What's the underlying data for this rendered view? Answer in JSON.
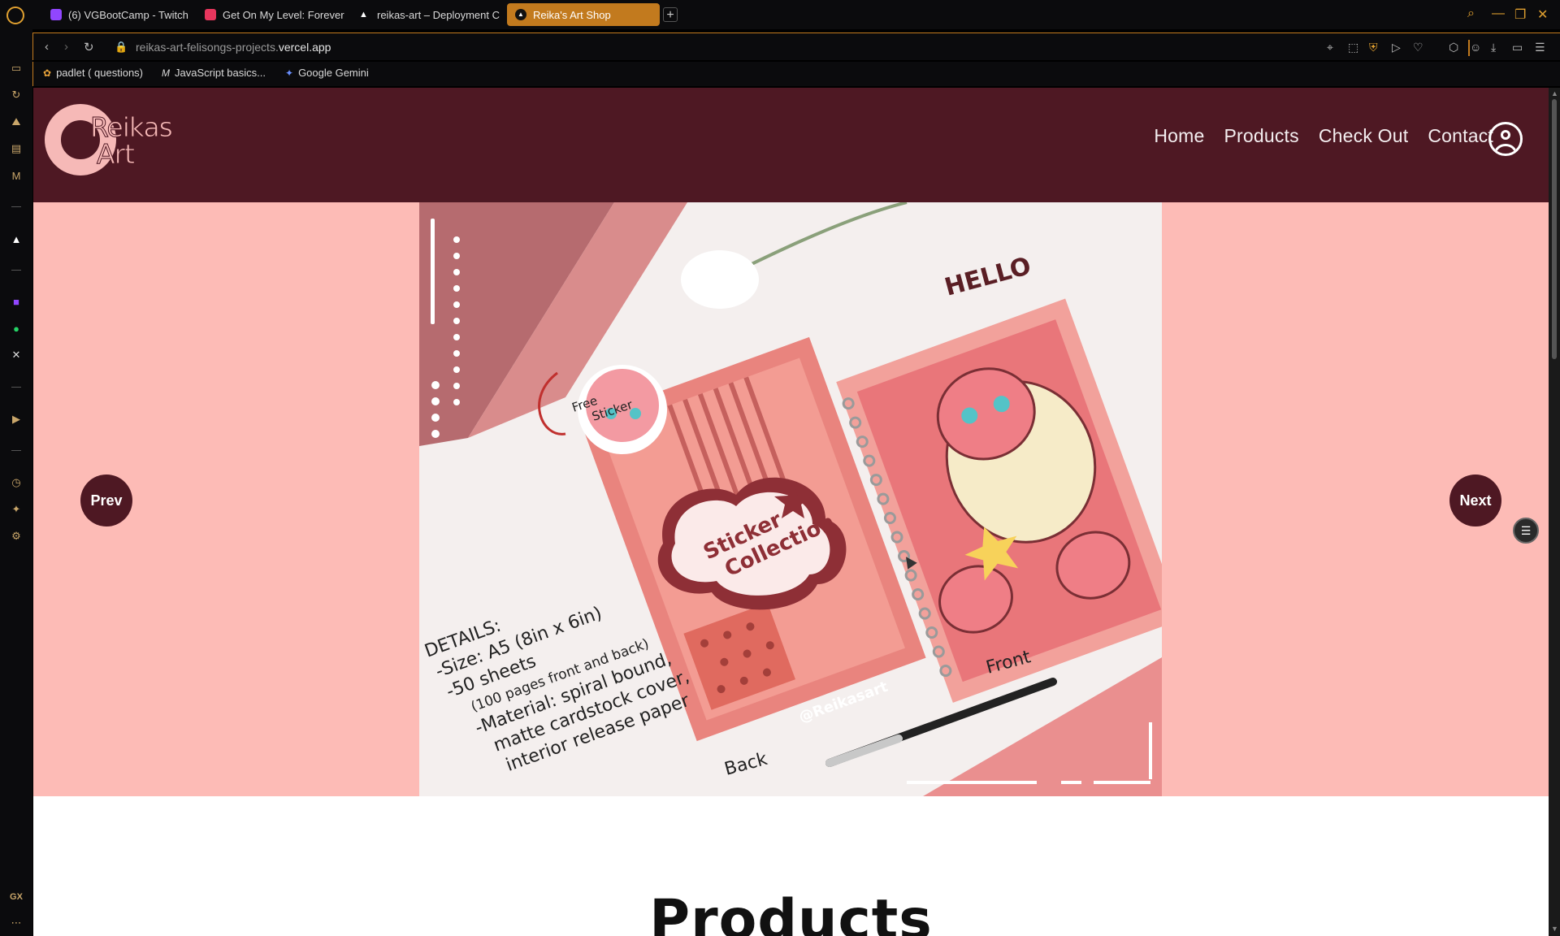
{
  "browser": {
    "tabs": [
      {
        "label": "(6) VGBootCamp - Twitch",
        "favicon_color": "#9146ff"
      },
      {
        "label": "Get On My Level: Forever",
        "favicon_color": "#e8365d"
      },
      {
        "label": "reikas-art – Deployment C",
        "favicon_color": "#ffffff"
      },
      {
        "label": "Reika's Art Shop",
        "favicon_color": "#000000",
        "active": true
      }
    ],
    "new_tab_label": "+",
    "url_path": "reikas-art-felisongs-projects.",
    "url_host": "vercel.app",
    "bookmarks": [
      {
        "label": "padlet ( questions)",
        "icon": "padlet-icon"
      },
      {
        "label": "JavaScript basics...",
        "icon": "medium-icon"
      },
      {
        "label": "Google Gemini",
        "icon": "gemini-icon"
      }
    ],
    "accent_color": "#c27a1e"
  },
  "sidebar_bottom_label": "GX",
  "site": {
    "logo_line1": "Reikas",
    "logo_line2": "Art",
    "nav": [
      "Home",
      "Products",
      "Check Out",
      "Contact"
    ],
    "header_color": "#4e1823",
    "hero_bg_color": "#fdbbb6"
  },
  "hero": {
    "prev_label": "Prev",
    "next_label": "Next",
    "slide": {
      "free_sticker": "Free\nSticker",
      "hello": "HELLO",
      "sticker_collection": "Sticker\nCollection",
      "details": [
        "DETAILS:",
        "-Size: A5 (8in x 6in)",
        "-50 sheets",
        "(100 pages front and back)",
        "-Material: spiral bound,",
        "matte cardstock cover,",
        "interior release paper"
      ],
      "handle": "@Reikasart",
      "back": "Back",
      "front": "Front"
    }
  },
  "products_heading": "Products"
}
